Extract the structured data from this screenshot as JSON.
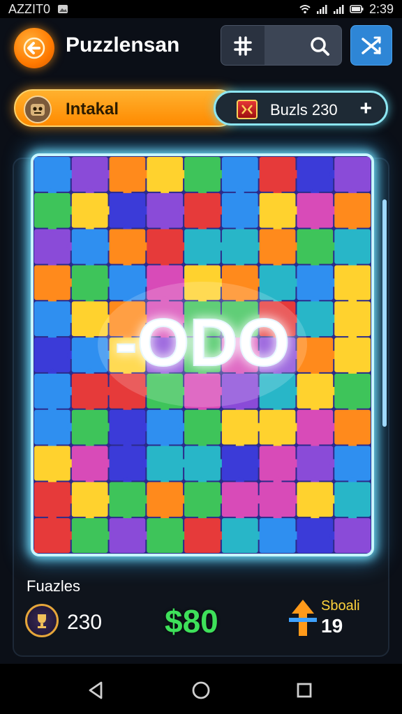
{
  "status_bar": {
    "carrier": "AZZIT0",
    "time": "2:39"
  },
  "header": {
    "title": "Puzzlensan",
    "back_icon": "arrow-left-icon",
    "grid_icon": "hash-icon",
    "search_icon": "search-icon",
    "shuffle_icon": "shuffle-icon"
  },
  "progress": {
    "label": "Intakal",
    "pill_label": "Buzls 230",
    "pill_action": "+"
  },
  "puzzle": {
    "overlay_text": "-ODO",
    "colors": [
      "#e63a3a",
      "#ff8a1c",
      "#ffd22e",
      "#3ec45a",
      "#2f8ff0",
      "#8a4bd8",
      "#d84bb8",
      "#3b3bd8",
      "#28b6c8"
    ]
  },
  "stats": {
    "title": "Fuazles",
    "puzzle_count": "230",
    "money": "$80",
    "score_label": "Sboali",
    "score_value": "19"
  },
  "colors": {
    "accent_orange": "#ff8a00",
    "glow_cyan": "#8de6f2",
    "money_green": "#3ee05a",
    "score_yellow": "#ffd33c"
  }
}
